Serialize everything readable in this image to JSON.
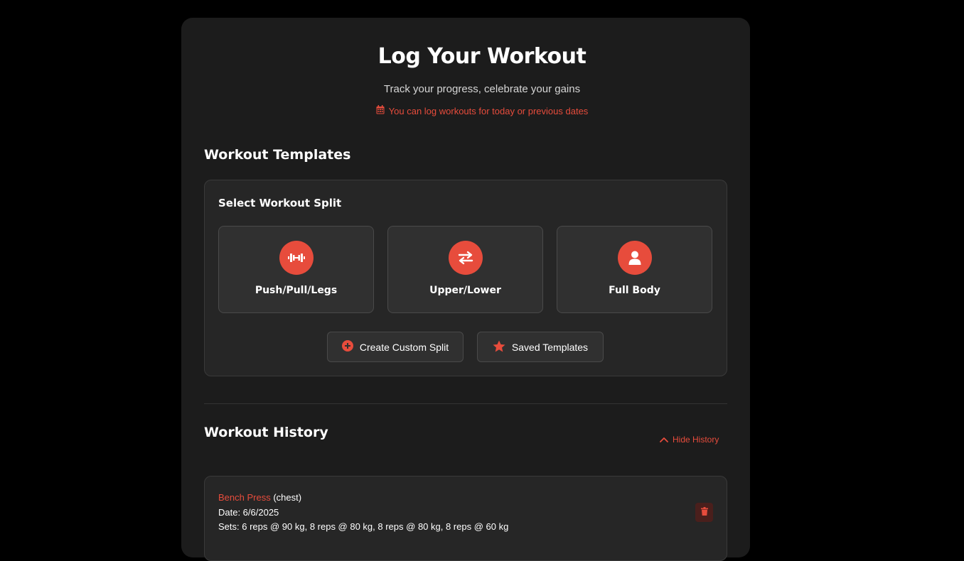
{
  "header": {
    "title": "Log Your Workout",
    "subtitle": "Track your progress, celebrate your gains",
    "notice": "You can log workouts for today or previous dates"
  },
  "templates": {
    "section_title": "Workout Templates",
    "box_title": "Select Workout Split",
    "splits": [
      {
        "label": "Push/Pull/Legs",
        "icon": "dumbbell-icon"
      },
      {
        "label": "Upper/Lower",
        "icon": "swap-arrows-icon"
      },
      {
        "label": "Full Body",
        "icon": "user-icon"
      }
    ],
    "create_custom_label": "Create Custom Split",
    "saved_templates_label": "Saved Templates"
  },
  "history": {
    "section_title": "Workout History",
    "toggle_label": "Hide History",
    "entries": [
      {
        "exercise": "Bench Press",
        "muscle": "(chest)",
        "date": "Date: 6/6/2025",
        "sets": "Sets: 6 reps @ 90 kg, 8 reps @ 80 kg, 8 reps @ 80 kg, 8 reps @ 60 kg"
      }
    ]
  },
  "colors": {
    "accent": "#e74c3c",
    "panel": "#1c1c1c",
    "card": "#262626",
    "background": "#000000"
  }
}
